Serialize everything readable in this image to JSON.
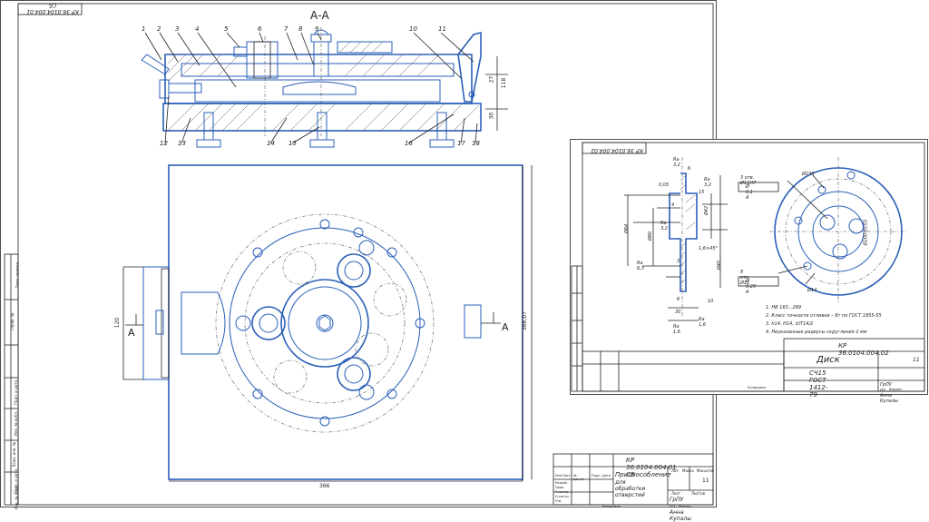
{
  "sheet1": {
    "doc_code_rotated": "КР 36.0104.004.01 СБ",
    "section_label": "А-А",
    "arrow_left": "А",
    "arrow_right": "А",
    "callouts": [
      "1",
      "2",
      "3",
      "4",
      "5",
      "6",
      "7",
      "8",
      "9",
      "10",
      "11",
      "12",
      "13",
      "14",
      "15",
      "16",
      "17",
      "18"
    ],
    "dims": {
      "d27": "27",
      "d118": "118",
      "d30": "30",
      "d366w": "366",
      "d366h": "366,07",
      "d120": "120"
    },
    "title_block": {
      "code": "КР 36.0104.004.01 СБ",
      "name_line1": "Приспособление",
      "name_line2": "для обработки отверстий",
      "sheet_count": "11",
      "org": "ГрПУ от. Анна Купалы",
      "head_cols": [
        "Изм",
        "Лист",
        "№ докум.",
        "Подп.",
        "Дата"
      ],
      "roles": [
        "Разраб.",
        "Пров.",
        "Т.контр.",
        "Н.контр.",
        "Утв."
      ],
      "lit": "Лит.",
      "mass": "Масса",
      "scale": "Масштаб",
      "sheet": "Лист",
      "sheets": "Листов",
      "copied": "Копировал",
      "format": "Формат"
    },
    "side_stamp": [
      "Перв. примен.",
      "Справ. №",
      "Подп. и дата",
      "Инв. № дубл.",
      "Взам. инв. №",
      "Подп. и дата",
      "Инв. № подл."
    ]
  },
  "sheet2": {
    "doc_code_rotated": "КР 36.0104.004.02",
    "dims": {
      "ra32a": "Ra 3,2",
      "ra32b": "Ra 3,2",
      "ra32c": "Ra 3,2",
      "ra63": "Ra 6,3",
      "ra16a": "Ra 1,6",
      "ra16b": "Ra 1,6",
      "d6": "6",
      "d4": "4",
      "d15": "15",
      "d10": "10",
      "d30": "30",
      "d6b": "6",
      "phi84": "Ø84",
      "phi80": "Ø80",
      "phi42": "Ø42",
      "phi40": "Ø40",
      "chamfer": "1,6×45°",
      "tol": "0,05",
      "dim3": "3",
      "phi230": "Ø230",
      "phi200": "Ø200±0,05",
      "phi14": "Ø14",
      "holes1": "3 отв. Ø11Н7",
      "holes2": "8 отв. Ø11",
      "pos1": "Ø 0,1 А",
      "pos2": "Ø 0,25 А"
    },
    "notes": [
      "1. НВ 163...299",
      "2. Класс точности отливки – 8т по ГОСТ 1855-55",
      "3. h14, H14, ±IT14/2",
      "4. Неуказанные радиусы скругления 2 мм"
    ],
    "title_block": {
      "code": "КР 36.0104.004.02",
      "name": "Диск",
      "material": "СЧ15 ГОСТ 1412-79",
      "org": "ГрПУ от. Анна Купалы",
      "sheet_count": "11",
      "copied": "Копировал",
      "format": "Формат"
    }
  }
}
